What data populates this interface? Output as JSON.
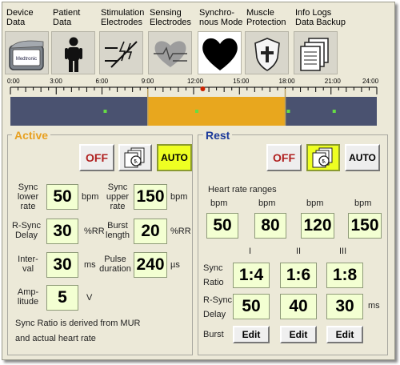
{
  "tabs": [
    {
      "label": "Device\nData",
      "icon": "device-icon"
    },
    {
      "label": "Patient\nData",
      "icon": "person-icon"
    },
    {
      "label": "Stimulation\nElectrodes",
      "icon": "electrode-icon"
    },
    {
      "label": "Sensing\nElectrodes",
      "icon": "heart-sensing-icon"
    },
    {
      "label": "Synchro-\nnous Mode",
      "icon": "heart-icon"
    },
    {
      "label": "Muscle\nProtection",
      "icon": "shield-icon"
    },
    {
      "label": "Info Logs\nData Backup",
      "icon": "logs-icon"
    }
  ],
  "device_icon_text": "Medtronic",
  "timeline": {
    "hours": [
      "0:00",
      "3:00",
      "6:00",
      "9:00",
      "12:00",
      "15:00",
      "18:00",
      "21:00",
      "24:00"
    ],
    "active_start_hour": 9,
    "active_end_hour": 18,
    "current_hour": 12.6
  },
  "active": {
    "title": "Active",
    "off": "OFF",
    "auto": "AUTO",
    "sync_lower_rate": {
      "label": "Sync\nlower\nrate",
      "value": "50",
      "unit": "bpm"
    },
    "sync_upper_rate": {
      "label": "Sync\nupper\nrate",
      "value": "150",
      "unit": "bpm"
    },
    "r_sync_delay": {
      "label": "R-Sync\nDelay",
      "value": "30",
      "unit": "%RR"
    },
    "burst_length": {
      "label": "Burst\nlength",
      "value": "20",
      "unit": "%RR"
    },
    "interval": {
      "label": "Inter-\nval",
      "value": "30",
      "unit": "ms"
    },
    "pulse_duration": {
      "label": "Pulse\nduration",
      "value": "240",
      "unit": "µs"
    },
    "amplitude": {
      "label": "Amp-\nlitude",
      "value": "5",
      "unit": "V"
    },
    "note": "Sync Ratio is derived from MUR\nand actual heart rate"
  },
  "rest": {
    "title": "Rest",
    "off": "OFF",
    "auto": "AUTO",
    "hr_title": "Heart rate ranges",
    "hr_unit": "bpm",
    "hr_values": [
      "50",
      "80",
      "120",
      "150"
    ],
    "roman": [
      "I",
      "II",
      "III"
    ],
    "sync_ratio_label": "Sync\nRatio",
    "sync_ratios": [
      "1:4",
      "1:6",
      "1:8"
    ],
    "rsync_label": "R-Sync\nDelay",
    "rsync_values": [
      "50",
      "40",
      "30"
    ],
    "rsync_unit": "ms",
    "burst_label": "Burst",
    "edit_label": "Edit"
  },
  "colors": {
    "active_title": "#e8a020",
    "rest_title": "#1b3a9a",
    "off_text": "#b02020",
    "auto_bg": "#eeff22",
    "value_bg": "#f3ffd2",
    "timeline_bar": "#4a5270",
    "timeline_active": "#e8a71e",
    "marker": "#cc2200"
  }
}
